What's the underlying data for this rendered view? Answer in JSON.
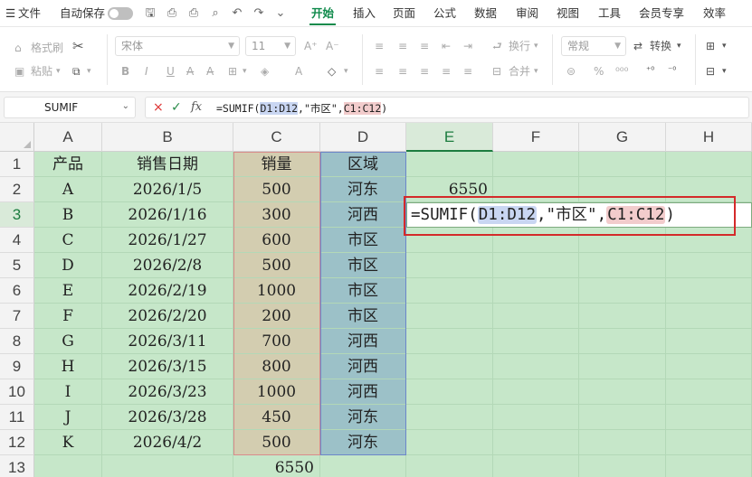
{
  "menubar": {
    "app_menu": "文件",
    "autosave_label": "自动保存",
    "tabs": [
      "开始",
      "插入",
      "页面",
      "公式",
      "数据",
      "审阅",
      "视图",
      "工具",
      "会员专享",
      "效率"
    ],
    "active_tab": "开始"
  },
  "ribbon": {
    "format_painter": "格式刷",
    "paste": "粘贴",
    "font_name": "宋体",
    "font_size": "11",
    "wrap_text": "换行",
    "merge": "合并",
    "number_format": "常规",
    "convert": "转换",
    "bold": "B",
    "italic": "I",
    "underline": "U"
  },
  "formula_bar": {
    "name_box": "SUMIF",
    "formula_prefix": "=SUMIF(",
    "ref1": "D1:D12",
    "middle": ",\"市区\",",
    "ref2": "C1:C12",
    "suffix": ")"
  },
  "grid": {
    "columns": [
      "A",
      "B",
      "C",
      "D",
      "E",
      "F",
      "G",
      "H"
    ],
    "rows": [
      "1",
      "2",
      "3",
      "4",
      "5",
      "6",
      "7",
      "8",
      "9",
      "10",
      "11",
      "12",
      "13"
    ],
    "header_row": [
      "产品",
      "销售日期",
      "销量",
      "区域"
    ],
    "data": [
      [
        "A",
        "2026/1/5",
        "500",
        "河东"
      ],
      [
        "B",
        "2026/1/16",
        "300",
        "河西"
      ],
      [
        "C",
        "2026/1/27",
        "600",
        "市区"
      ],
      [
        "D",
        "2026/2/8",
        "500",
        "市区"
      ],
      [
        "E",
        "2026/2/19",
        "1000",
        "市区"
      ],
      [
        "F",
        "2026/2/20",
        "200",
        "市区"
      ],
      [
        "G",
        "2026/3/11",
        "700",
        "河西"
      ],
      [
        "H",
        "2026/3/15",
        "800",
        "河西"
      ],
      [
        "I",
        "2026/3/23",
        "1000",
        "河西"
      ],
      [
        "J",
        "2026/3/28",
        "450",
        "河东"
      ],
      [
        "K",
        "2026/4/2",
        "500",
        "河东"
      ]
    ],
    "e2_value": "6550",
    "c13_value": "6550",
    "edit_formula": {
      "prefix": "=SUMIF(",
      "ref1": "D1:D12",
      "middle": ",\"市区\",",
      "ref2": "C1:C12",
      "suffix": ")"
    }
  },
  "colors": {
    "accent": "#0f8a4b",
    "grid_bg": "#c6e7c9",
    "sales_highlight": "#d3cdb0",
    "region_highlight": "#9cc1c8",
    "annotation_border": "#d42a2a"
  }
}
